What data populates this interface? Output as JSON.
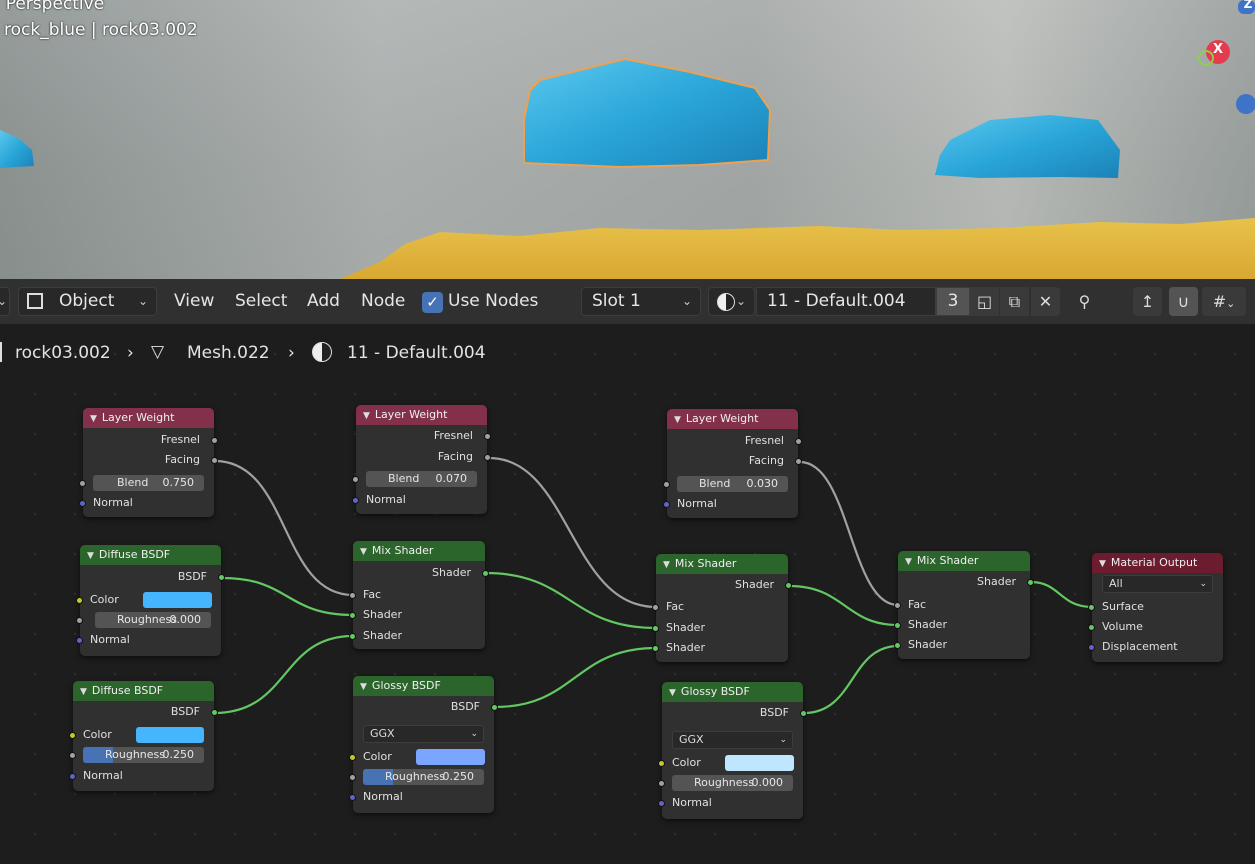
{
  "viewport": {
    "mode_label": "Perspective",
    "object_label": "rock_blue | rock03.002",
    "gizmo_x_label": "X",
    "gizmo_z_label": "Z"
  },
  "header": {
    "mode": "Object",
    "menus": [
      "View",
      "Select",
      "Add",
      "Node"
    ],
    "use_nodes_label": "Use Nodes",
    "use_nodes_checked": true,
    "slot": "Slot 1",
    "material_name": "11 - Default.004",
    "user_count": "3"
  },
  "breadcrumb": {
    "object": "rock03.002",
    "mesh": "Mesh.022",
    "material": "11 - Default.004"
  },
  "nodes": {
    "lw1": {
      "title": "Layer Weight",
      "fresnel": "Fresnel",
      "facing": "Facing",
      "blend_label": "Blend",
      "blend_value": "0.750",
      "normal": "Normal"
    },
    "lw2": {
      "title": "Layer Weight",
      "fresnel": "Fresnel",
      "facing": "Facing",
      "blend_label": "Blend",
      "blend_value": "0.070",
      "normal": "Normal"
    },
    "lw3": {
      "title": "Layer Weight",
      "fresnel": "Fresnel",
      "facing": "Facing",
      "blend_label": "Blend",
      "blend_value": "0.030",
      "normal": "Normal"
    },
    "diff1": {
      "title": "Diffuse BSDF",
      "out": "BSDF",
      "color_label": "Color",
      "color": "#45b6fe",
      "rough_label": "Roughness",
      "rough_value": "0.000",
      "rough_fill": 0.0,
      "normal": "Normal"
    },
    "diff2": {
      "title": "Diffuse BSDF",
      "out": "BSDF",
      "color_label": "Color",
      "color": "#45b6fe",
      "rough_label": "Roughness",
      "rough_value": "0.250",
      "rough_fill": 0.25,
      "normal": "Normal"
    },
    "mix1": {
      "title": "Mix Shader",
      "out": "Shader",
      "fac": "Fac",
      "shader1": "Shader",
      "shader2": "Shader"
    },
    "mix2": {
      "title": "Mix Shader",
      "out": "Shader",
      "fac": "Fac",
      "shader1": "Shader",
      "shader2": "Shader"
    },
    "mix3": {
      "title": "Mix Shader",
      "out": "Shader",
      "fac": "Fac",
      "shader1": "Shader",
      "shader2": "Shader"
    },
    "glossy1": {
      "title": "Glossy BSDF",
      "out": "BSDF",
      "dist": "GGX",
      "color_label": "Color",
      "color": "#7aa6ff",
      "rough_label": "Roughness",
      "rough_value": "0.250",
      "rough_fill": 0.25,
      "normal": "Normal"
    },
    "glossy2": {
      "title": "Glossy BSDF",
      "out": "BSDF",
      "dist": "GGX",
      "color_label": "Color",
      "color": "#bfe6ff",
      "rough_label": "Roughness",
      "rough_value": "0.000",
      "rough_fill": 0.0,
      "normal": "Normal"
    },
    "output": {
      "title": "Material Output",
      "target": "All",
      "surface": "Surface",
      "volume": "Volume",
      "displacement": "Displacement"
    }
  },
  "colors": {
    "input_header": "#83314a",
    "shader_header": "#2b652b",
    "output_header": "#6b1c2e",
    "shader_link": "#63c763",
    "float_link": "#a1a1a1",
    "accent": "#4772b3",
    "selection_outline": "#f0a050"
  }
}
